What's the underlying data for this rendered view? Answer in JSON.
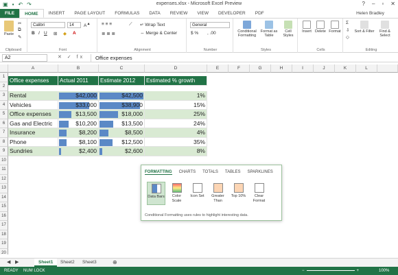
{
  "window": {
    "title": "expenses.xlsx - Microsoft Excel Preview",
    "user": "Helen Bradley"
  },
  "ribbon_tabs": [
    "FILE",
    "HOME",
    "INSERT",
    "PAGE LAYOUT",
    "FORMULAS",
    "DATA",
    "REVIEW",
    "VIEW",
    "DEVELOPER",
    "PDF"
  ],
  "ribbon": {
    "paste": "Paste",
    "clipboard": "Clipboard",
    "font_name": "Calibri",
    "font_size": "14",
    "font": "Font",
    "wrap_text": "Wrap Text",
    "merge_center": "Merge & Center",
    "alignment": "Alignment",
    "number_format": "General",
    "number": "Number",
    "conditional_formatting": "Conditional Formatting",
    "format_as_table": "Format as Table",
    "cell_styles": "Cell Styles",
    "styles": "Styles",
    "insert": "Insert",
    "delete": "Delete",
    "format": "Format",
    "cells": "Cells",
    "sort_filter": "Sort & Filter",
    "find_select": "Find & Select",
    "editing": "Editing"
  },
  "formula_bar": {
    "name_box": "A2",
    "fx": "✕ ✓ fx",
    "content": "Office expenses"
  },
  "columns": [
    "A",
    "B",
    "C",
    "D",
    "E",
    "F",
    "G",
    "H",
    "I",
    "J",
    "K",
    "L"
  ],
  "rows": [
    "1",
    "2",
    "3",
    "4",
    "5",
    "6",
    "7",
    "8",
    "9",
    "10",
    "11",
    "12",
    "13",
    "14",
    "15",
    "16",
    "17",
    "18",
    "19",
    "20"
  ],
  "table": {
    "headers": [
      "Office expenses",
      "Actual 2011",
      "Estimate 2012",
      "Estimated % growth"
    ],
    "rows": [
      {
        "label": "Rental",
        "actual": "$42,000",
        "estimate": "$42,500",
        "growth": "1%",
        "actual_bar": 1.0,
        "estimate_bar": 1.0
      },
      {
        "label": "Vehicles",
        "actual": "$33,000",
        "estimate": "$38,900",
        "growth": "15%",
        "actual_bar": 0.786,
        "estimate_bar": 0.915
      },
      {
        "label": "Office expenses",
        "actual": "$13,500",
        "estimate": "$18,000",
        "growth": "25%",
        "actual_bar": 0.321,
        "estimate_bar": 0.424
      },
      {
        "label": "Gas and Electric",
        "actual": "$10,200",
        "estimate": "$13,500",
        "growth": "24%",
        "actual_bar": 0.243,
        "estimate_bar": 0.318
      },
      {
        "label": "Insurance",
        "actual": "$8,200",
        "estimate": "$8,500",
        "growth": "4%",
        "actual_bar": 0.195,
        "estimate_bar": 0.2
      },
      {
        "label": "Phone",
        "actual": "$8,100",
        "estimate": "$12,500",
        "growth": "35%",
        "actual_bar": 0.193,
        "estimate_bar": 0.294
      },
      {
        "label": "Sundries",
        "actual": "$2,400",
        "estimate": "$2,600",
        "growth": "8%",
        "actual_bar": 0.057,
        "estimate_bar": 0.061
      }
    ]
  },
  "quick_analysis": {
    "tabs": [
      "FORMATTING",
      "CHARTS",
      "TOTALS",
      "TABLES",
      "SPARKLINES"
    ],
    "items": [
      "Data Bars",
      "Color Scale",
      "Icon Set",
      "Greater Than",
      "Top 10%",
      "Clear Format"
    ],
    "description": "Conditional Formatting uses rules to highlight interesting data."
  },
  "sheets": [
    "Sheet1",
    "Sheet2",
    "Sheet3"
  ],
  "status": {
    "ready": "READY",
    "numlock": "NUM LOCK",
    "zoom": "100%"
  },
  "colors": {
    "accent": "#217346",
    "header_fill": "#217346",
    "row_fill": "#d9ead3",
    "data_bar": "#5b89c6"
  }
}
